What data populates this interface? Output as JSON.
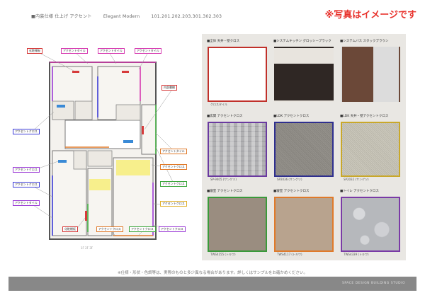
{
  "header": {
    "spec": "■内装仕様 仕上げ アクセント",
    "style": "Elegant Modern",
    "rooms": "101.201.202.203.301.302.303"
  },
  "notice": "※写真はイメージです",
  "floorplan": {
    "tags": [
      {
        "text": "化粧棚板",
        "color": "#d63a3a"
      },
      {
        "text": "アクセントタイル",
        "color": "#d63ab0"
      },
      {
        "text": "アクセントタイル",
        "color": "#d63ab0"
      },
      {
        "text": "アクセントタイル",
        "color": "#d63ab0"
      },
      {
        "text": "内部書棚",
        "color": "#d63a3a"
      },
      {
        "text": "アクセントクロス",
        "color": "#3a3ad6"
      },
      {
        "text": "アクセントタイル",
        "color": "#e07a2a"
      },
      {
        "text": "アクセントクロス",
        "color": "#9b3ad6"
      },
      {
        "text": "アクセントクロス",
        "color": "#e07a2a"
      },
      {
        "text": "アクセントクロス",
        "color": "#3a3ad6"
      },
      {
        "text": "アクセントクロス",
        "color": "#3aa63a"
      },
      {
        "text": "アクセントタイル",
        "color": "#9b3ad6"
      },
      {
        "text": "アクセントクロス",
        "color": "#e0b02a"
      },
      {
        "text": "化粧棚板",
        "color": "#d63a3a"
      },
      {
        "text": "アクセントクロス",
        "color": "#e07a2a"
      },
      {
        "text": "アクセントクロス",
        "color": "#3aa63a"
      },
      {
        "text": "アクセントクロス",
        "color": "#9b3ad6"
      }
    ],
    "scale_label": "1F  2F  3F"
  },
  "swatches": [
    {
      "label": "■全体 天井・壁クロス",
      "sub": "",
      "code": "クロスタイル",
      "color": "#ffffff",
      "border": "#c0302a",
      "kind": "plain"
    },
    {
      "label": "■システムキッチン グロッシーブラック",
      "sub": "",
      "code": "",
      "color": "#3a2f2c",
      "border": "transparent",
      "kind": "kitchen"
    },
    {
      "label": "■システムバス スタックブラウン",
      "sub": "",
      "code": "",
      "color": "#5b3a2c",
      "border": "transparent",
      "kind": "bath"
    },
    {
      "label": "■玄関 アクセントクロス",
      "sub": "",
      "code": "SP-9405 (サンゲツ)",
      "color": "#bcbcbe",
      "border": "#6a3aa0",
      "kind": "pattern"
    },
    {
      "label": "■LDK アクセントクロス",
      "sub": "",
      "code": "SP2036 (サンゲツ)",
      "color": "#8f8c86",
      "border": "#2f2f8f",
      "kind": "texture"
    },
    {
      "label": "■LDK 天井・壁アクセントクロス",
      "sub": "",
      "code": "SP2032 (サンゲツ)",
      "color": "#c9c6b8",
      "border": "#c9a82a",
      "kind": "texture"
    },
    {
      "label": "■寝室 アクセントクロス",
      "sub": "",
      "code": "TWS4155 (トキワ)",
      "color": "#9a8d80",
      "border": "#3a9a3a",
      "kind": "plain"
    },
    {
      "label": "■寝室 アクセントクロス",
      "sub": "",
      "code": "TWS4117 (トキワ)",
      "color": "#b8a38e",
      "border": "#e07a2a",
      "kind": "plain"
    },
    {
      "label": "■トイレ アクセントクロス",
      "sub": "",
      "code": "TWS4339 (トキワ)",
      "color": "#b6b8bc",
      "border": "#7a3aa6",
      "kind": "marble"
    }
  ],
  "footer": {
    "note": "※仕様・形状・色調等は、実際のものと多少異なる場合があります。詳しくはサンプルをお確かめください。",
    "logo": "SPACE DESIGN BUILDING STUDIO"
  }
}
